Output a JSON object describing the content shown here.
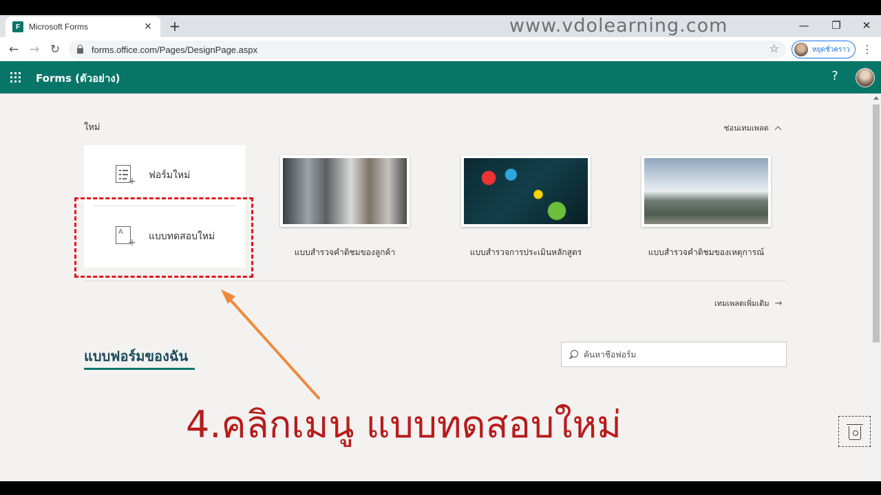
{
  "browser": {
    "tab_title": "Microsoft Forms",
    "tab_favicon_letter": "F",
    "watermark": "www.vdolearning.com",
    "url": "forms.office.com/Pages/DesignPage.aspx",
    "profile_label": "หยุดชั่วคราว"
  },
  "app": {
    "title": "Forms (ตัวอย่าง)"
  },
  "templates_section": {
    "heading": "ใหม่",
    "hide_link": "ซ่อนเทมเพลต",
    "new_form_label": "ฟอร์มใหม่",
    "new_quiz_label": "แบบทดสอบใหม่",
    "quiz_icon_letter": "A",
    "cards": [
      {
        "caption": "แบบสำรวจคำติชมของลูกค้า"
      },
      {
        "caption": "แบบสำรวจการประเมินหลักสูตร"
      },
      {
        "caption": "แบบสำรวจคำติชมของเหตุการณ์"
      }
    ],
    "more_link": "เทมเพลตเพิ่มเติม"
  },
  "my_forms": {
    "heading": "แบบฟอร์มของฉัน",
    "search_placeholder": "ค้นหาชื่อฟอร์ม"
  },
  "annotation": {
    "instruction": "4.คลิกเมนู  แบบทดสอบใหม่",
    "highlight_color": "#e0141e",
    "arrow_color": "#ee8a3c",
    "text_color": "#b71c1c"
  },
  "colors": {
    "brand": "#077568"
  }
}
